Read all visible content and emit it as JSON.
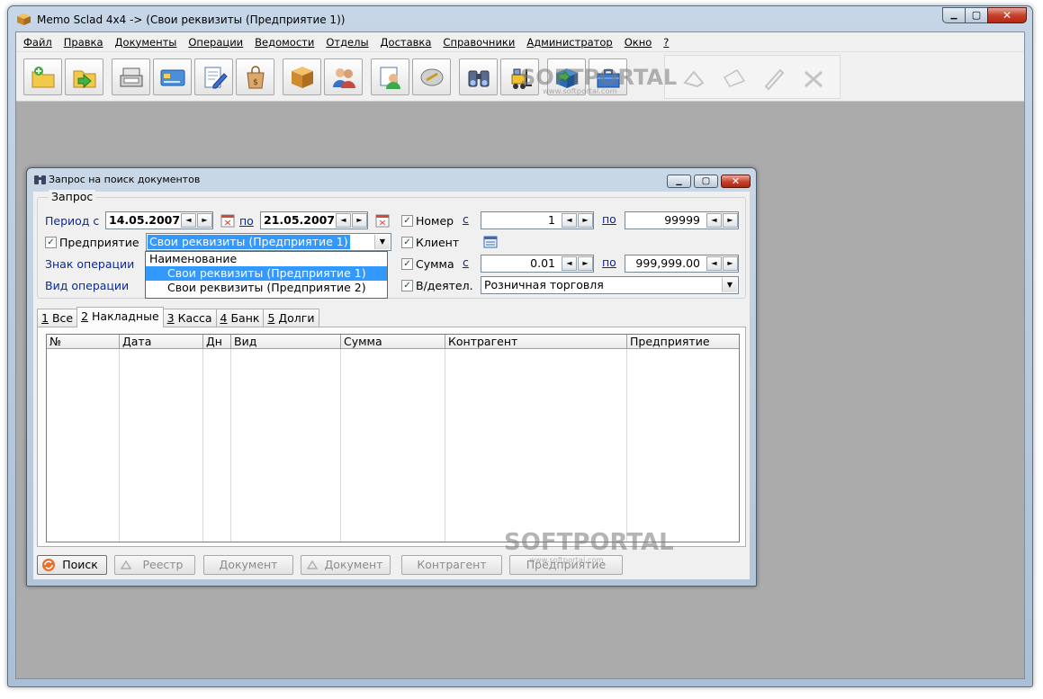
{
  "window": {
    "title": "Memo Sclad 4x4 -> (Свои реквизиты (Предприятие 1))",
    "min_glyph": "▁",
    "max_glyph": "▢",
    "close_glyph": "✕"
  },
  "menu": [
    "Файл",
    "Правка",
    "Документы",
    "Операции",
    "Ведомости",
    "Отделы",
    "Доставка",
    "Справочники",
    "Администратор",
    "Окно",
    "?"
  ],
  "toolbar": {
    "buttons": [
      "folder-add-icon",
      "folder-import-icon",
      "cash-register-icon",
      "card-icon",
      "document-edit-icon",
      "shopping-bag-icon",
      "box-icon",
      "users-icon",
      "client-card-icon",
      "search-link-icon",
      "binoculars-icon",
      "forklift-icon",
      "delivery-icon",
      "toolbox-icon"
    ],
    "disabled_buttons": [
      "disabled-1-icon",
      "disabled-2-icon",
      "disabled-3-icon",
      "disabled-4-icon"
    ]
  },
  "watermarks": {
    "top": "SOFTPORTAL",
    "top_sub": "www.softportal.com",
    "bottom": "SOFTPORTAL",
    "bottom_sub": "www.softportal.com"
  },
  "dialog": {
    "title": "Запрос на поиск документов",
    "group_label": "Запрос",
    "period_label": "Период с",
    "date_from": "14.05.2007",
    "date_to": "21.05.2007",
    "po": "по",
    "s": "с",
    "enterprise_label": "Предприятие",
    "enterprise_value": "Свои реквизиты (Предприятие 1)",
    "operation_sign_label": "Знак операции",
    "operation_kind_label": "Вид операции",
    "number_label": "Номер",
    "number_from": "1",
    "number_to": "99999",
    "client_label": "Клиент",
    "sum_label": "Сумма",
    "sum_from": "0.01",
    "sum_to": "999,999.00",
    "activity_label": "В/деятел.",
    "activity_value": "Розничная торговля",
    "checkmark": "✓",
    "spin_left": "◄",
    "spin_right": "►",
    "combo_arrow": "▼",
    "dropdown": {
      "header": "Наименование",
      "items": [
        "Свои реквизиты (Предприятие 1)",
        "Свои реквизиты (Предприятие 2)"
      ]
    },
    "tabs": [
      {
        "num": "1",
        "label": "Все"
      },
      {
        "num": "2",
        "label": "Накладные"
      },
      {
        "num": "3",
        "label": "Касса"
      },
      {
        "num": "4",
        "label": "Банк"
      },
      {
        "num": "5",
        "label": "Долги"
      }
    ],
    "columns": [
      "№",
      "Дата",
      "Дн",
      "Вид",
      "Сумма",
      "Контрагент",
      "Предприятие"
    ],
    "buttons": {
      "search": "Поиск",
      "registry": "Реестр",
      "document1": "Документ",
      "document2": "Документ",
      "counterparty": "Контрагент",
      "enterprise": "Предприятие"
    }
  }
}
